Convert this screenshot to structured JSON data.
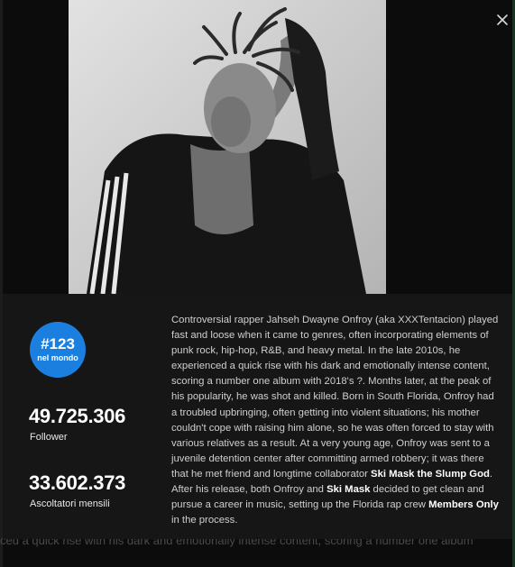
{
  "backdrop": {
    "snippet": "ced a quick rise with his dark and emotionally intense content, scoring a number one album"
  },
  "close": {
    "icon": "close-icon"
  },
  "photo": {
    "alt": "Black and white portrait of the artist"
  },
  "stats": {
    "rank_number": "#123",
    "rank_label": "nel mondo",
    "followers_value": "49.725.306",
    "followers_label": "Follower",
    "listeners_value": "33.602.373",
    "listeners_label": "Ascoltatori mensili"
  },
  "colors": {
    "badge": "#1b7fe0",
    "panel": "#161616"
  },
  "bio": {
    "part1": "Controversial rapper Jahseh Dwayne Onfroy (aka XXXTentacion) played fast and loose when it came to genres, often incorporating elements of punk rock, hip-hop, R&B, and heavy metal. In the late 2010s, he experienced a quick rise with his dark and emotionally intense content, scoring a number one album with 2018's ?. Months later, at the peak of his popularity, he was shot and killed. Born in South Florida, Onfroy had a troubled upbringing, often getting into violent situations; his mother couldn't cope with raising him alone, so he was often forced to stay with various relatives as a result. At a very young age, Onfroy was sent to a juvenile detention center after committing armed robbery; it was there that he met friend and longtime collaborator ",
    "link1": "Ski Mask the Slump God",
    "part2": ". After his release, both Onfroy and ",
    "link2": "Ski Mask",
    "part3": " decided to get clean and pursue a career in music, setting up the Florida rap crew ",
    "link3": "Members Only",
    "part4": " in the process."
  }
}
